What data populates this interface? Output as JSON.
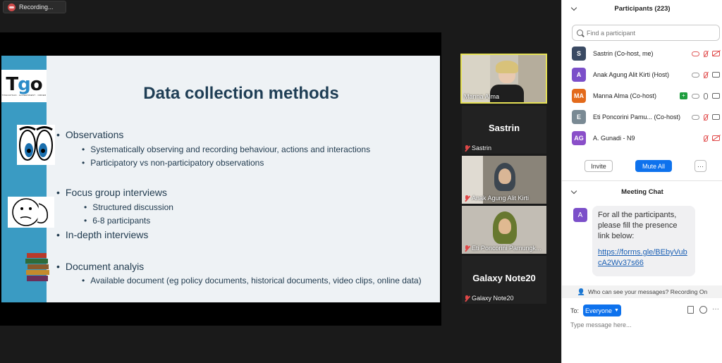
{
  "recording": {
    "label": "Recording..."
  },
  "slide": {
    "logo": {
      "t": "T",
      "g": "g",
      "o": "o",
      "sub": "TINGKATKAN · GOVERNMENT · ORDER"
    },
    "title": "Data collection methods",
    "bullets": [
      {
        "text": "Observations",
        "sub": [
          "Systematically observing and recording behaviour, actions and interactions",
          "Participatory vs non-participatory observations"
        ]
      },
      {
        "text": "Focus group interviews",
        "sub": [
          "Structured discussion",
          "6-8 participants"
        ]
      },
      {
        "text": "In-depth interviews",
        "sub": []
      },
      {
        "text": "Document analyis",
        "sub": [
          "Available document (eg policy documents, historical documents, video clips, online data)"
        ]
      }
    ]
  },
  "tiles": [
    {
      "name": "Manna Alma",
      "type": "video",
      "active": true
    },
    {
      "name": "Sastrin",
      "big": "Sastrin",
      "type": "name",
      "muted": true
    },
    {
      "name": "Anak Agung Alit Kirti",
      "type": "video",
      "muted": true
    },
    {
      "name": "Eti Poncorini Pamungk...",
      "type": "video",
      "muted": true
    },
    {
      "name": "Galaxy Note20",
      "big": "Galaxy Note20",
      "type": "name",
      "muted": true
    }
  ],
  "participants": {
    "header": "Participants (223)",
    "search_placeholder": "Find a participant",
    "list": [
      {
        "initials": "S",
        "name": "Sastrin (Co-host, me)",
        "color": "#3a4a63"
      },
      {
        "initials": "A",
        "name": "Anak Agung Alit Kirti (Host)",
        "color": "#7b4fc9"
      },
      {
        "initials": "MA",
        "name": "Manna Alma (Co-host)",
        "color": "#e36a1b"
      },
      {
        "initials": "E",
        "name": "Eti Poncorini Pamu... (Co-host)",
        "color": "#7a8a94"
      },
      {
        "initials": "AG",
        "name": "A. Gunadi - N9",
        "color": "#8a4fc9"
      }
    ],
    "invite": "Invite",
    "mute_all": "Mute All",
    "more": "···"
  },
  "chat": {
    "header": "Meeting Chat",
    "sender_initial": "A",
    "message": "For all the participants, please fill the presence link below:",
    "link": "https://forms.gle/BEbyVubcA2Wv37s66",
    "who_can_see": "Who can see your messages? Recording On",
    "to": "To:",
    "recipient": "Everyone",
    "input_placeholder": "Type message here..."
  }
}
